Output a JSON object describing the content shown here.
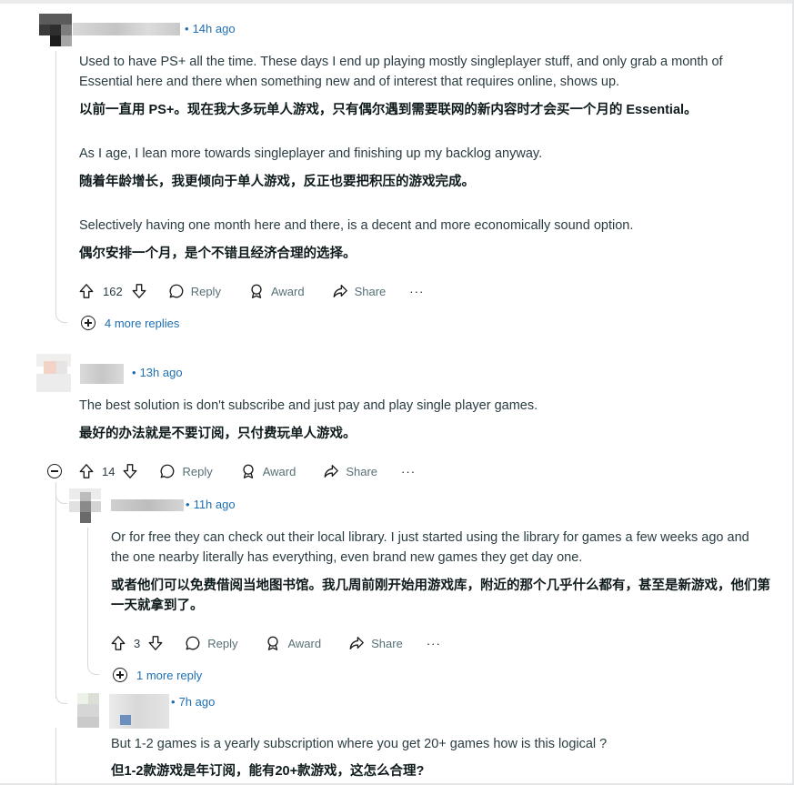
{
  "comments": [
    {
      "time": "14h ago",
      "paragraphs": [
        {
          "en": "Used to have PS+ all the time. These days I end up playing mostly singleplayer stuff, and only grab a month of Essential here and there when something new and of interest that requires online, shows up.",
          "cn": "以前一直用 PS+。现在我大多玩单人游戏，只有偶尔遇到需要联网的新内容时才会买一个月的 Essential。"
        },
        {
          "en": "As I age, I lean more towards singleplayer and finishing up my backlog anyway.",
          "cn": "随着年龄增长，我更倾向于单人游戏，反正也要把积压的游戏完成。"
        },
        {
          "en": "Selectively having one month here and there, is a decent and more economically sound option.",
          "cn": "偶尔安排一个月，是个不错且经济合理的选择。"
        }
      ],
      "votes": "162",
      "more_replies": "4 more replies"
    },
    {
      "time": "13h ago",
      "paragraphs": [
        {
          "en": "The best solution is don't subscribe and just pay and play single player games.",
          "cn": "最好的办法就是不要订阅，只付费玩单人游戏。"
        }
      ],
      "votes": "14"
    },
    {
      "time": "11h ago",
      "paragraphs": [
        {
          "en": "Or for free they can check out their local library. I just started using the library for games a few weeks ago and the one nearby literally has everything, even brand new games they get day one.",
          "cn": "或者他们可以免费借阅当地图书馆。我几周前刚开始用游戏库，附近的那个几乎什么都有，甚至是新游戏，他们第一天就拿到了。"
        }
      ],
      "votes": "3",
      "more_replies": "1 more reply"
    },
    {
      "time": "7h ago",
      "paragraphs": [
        {
          "en": "But 1-2 games is a yearly subscription where you get 20+ games how is this logical ?",
          "cn": "但1-2款游戏是年订阅，能有20+款游戏，这怎么合理?"
        }
      ]
    }
  ],
  "actions": {
    "reply": "Reply",
    "award": "Award",
    "share": "Share",
    "more": "···"
  },
  "icons": [
    "upvote-icon",
    "downvote-icon",
    "comment-icon",
    "award-icon",
    "share-icon",
    "more-icon",
    "expand-icon",
    "collapse-icon"
  ]
}
